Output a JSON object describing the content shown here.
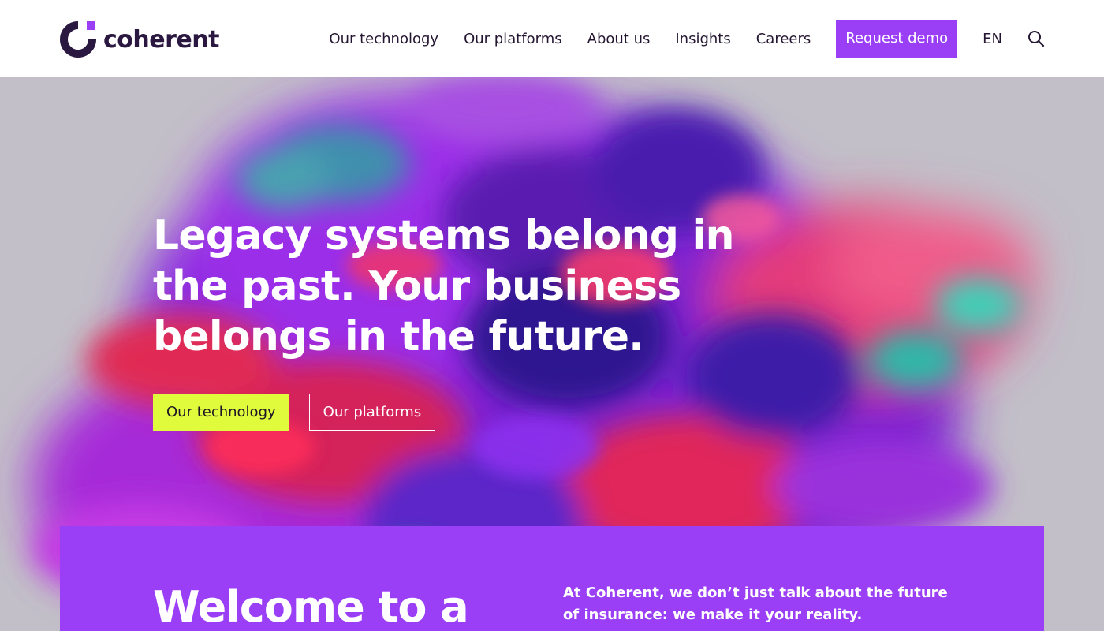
{
  "header": {
    "logo_text": "coherent",
    "nav": [
      {
        "label": "Our technology"
      },
      {
        "label": "Our platforms"
      },
      {
        "label": "About us"
      },
      {
        "label": "Insights"
      },
      {
        "label": "Careers"
      }
    ],
    "cta_label": "Request demo",
    "language": "EN",
    "search_icon": "search-icon"
  },
  "hero": {
    "title": "Legacy systems belong in the past. Your business belongs in the future.",
    "primary_cta": "Our technology",
    "secondary_cta": "Our platforms"
  },
  "welcome": {
    "heading": "Welcome to a",
    "intro": "At Coherent, we don’t just talk about the future of insurance: we make it your reality."
  },
  "colors": {
    "brand_purple": "#9b3ff7",
    "lime": "#e0fb3c",
    "dark": "#241631"
  }
}
